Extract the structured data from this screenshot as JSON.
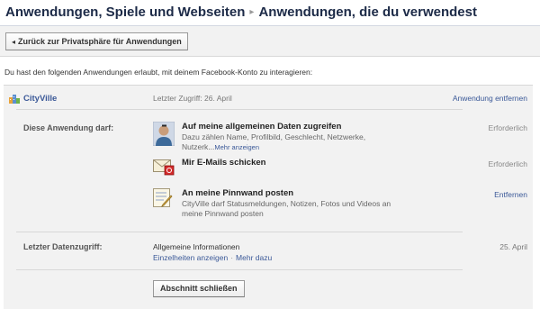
{
  "header": {
    "title_part1": "Anwendungen, Spiele und Webseiten",
    "separator": "▸",
    "title_part2": "Anwendungen, die du verwendest"
  },
  "back_button": {
    "arrow": "◂",
    "label": "Zurück zur Privatsphäre für Anwendungen"
  },
  "intro_text": "Du hast den folgenden Anwendungen erlaubt, mit deinem Facebook-Konto zu interagieren:",
  "app": {
    "name": "CityVille",
    "last_access": "Letzter Zugriff: 26. April",
    "remove_label": "Anwendung entfernen",
    "icon": "cityville-icon"
  },
  "permissions_label": "Diese Anwendung darf:",
  "permissions": [
    {
      "title": "Auf meine allgemeinen Daten zugreifen",
      "description": "Dazu zählen Name, Profilbild, Geschlecht, Netzwerke, Nutzerk...",
      "more": "Mehr anzeigen",
      "status": "Erforderlich",
      "icon": "profile-photo-icon"
    },
    {
      "title": "Mir E-Mails schicken",
      "status": "Erforderlich",
      "icon": "email-icon"
    },
    {
      "title": "An meine Pinnwand posten",
      "description": "CityVille darf Statusmeldungen, Notizen, Fotos und Videos an meine Pinnwand posten",
      "status": "Entfernen",
      "icon": "wall-post-icon"
    }
  ],
  "data_access": {
    "label": "Letzter Datenzugriff:",
    "value": "Allgemeine Informationen",
    "details_link": "Einzelheiten anzeigen",
    "dot": "·",
    "more_link": "Mehr dazu",
    "date": "25. April"
  },
  "close_button": "Abschnitt schließen",
  "colors": {
    "link": "#3b5998",
    "title": "#1c2a47",
    "panel": "#f2f2f2"
  }
}
